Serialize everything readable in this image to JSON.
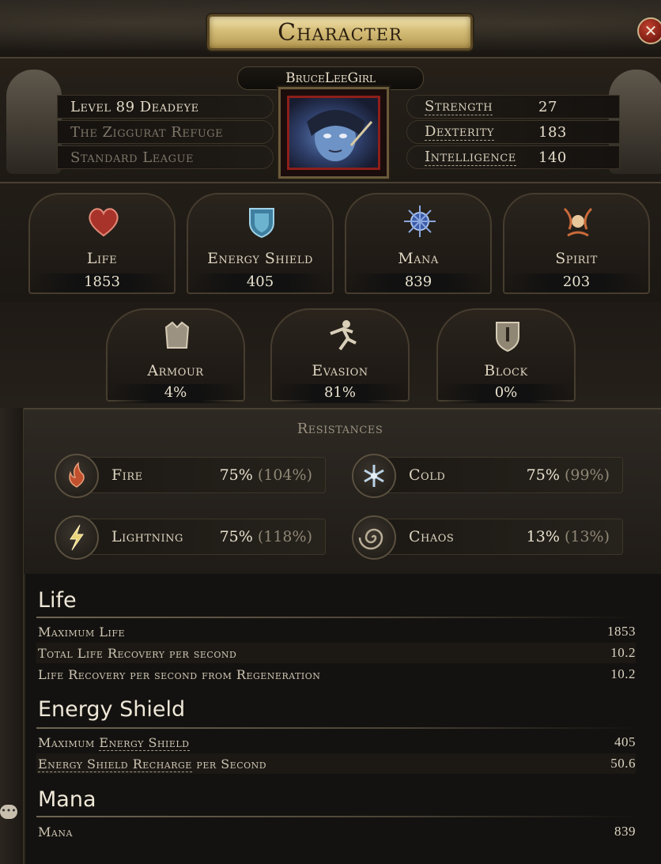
{
  "window": {
    "title": "Character",
    "close_icon": "close-icon"
  },
  "character": {
    "name": "BruceLeeGirl",
    "level_class": "Level 89 Deadeye",
    "location": "The Ziggurat Refuge",
    "league": "Standard League"
  },
  "attributes": [
    {
      "label": "Strength",
      "value": "27"
    },
    {
      "label": "Dexterity",
      "value": "183"
    },
    {
      "label": "Intelligence",
      "value": "140"
    }
  ],
  "main_stats": [
    {
      "label": "Life",
      "value": "1853",
      "icon": "heart-icon"
    },
    {
      "label": "Energy Shield",
      "value": "405",
      "icon": "shield-icon"
    },
    {
      "label": "Mana",
      "value": "839",
      "icon": "mana-icon"
    },
    {
      "label": "Spirit",
      "value": "203",
      "icon": "spirit-icon"
    }
  ],
  "defences": [
    {
      "label": "Armour",
      "value": "4%",
      "icon": "armour-icon"
    },
    {
      "label": "Evasion",
      "value": "81%",
      "icon": "evasion-icon"
    },
    {
      "label": "Block",
      "value": "0%",
      "icon": "block-shield-icon"
    }
  ],
  "resistances": {
    "title": "Resistances",
    "items": [
      {
        "label": "Fire",
        "value": "75%",
        "max": "(104%)",
        "icon": "fire-icon",
        "color": "#c1502e"
      },
      {
        "label": "Cold",
        "value": "75%",
        "max": "(99%)",
        "icon": "snowflake-icon",
        "color": "#bcd3e6"
      },
      {
        "label": "Lightning",
        "value": "75%",
        "max": "(118%)",
        "icon": "lightning-icon",
        "color": "#e8d37a"
      },
      {
        "label": "Chaos",
        "value": "13%",
        "max": "(13%)",
        "icon": "chaos-spiral-icon",
        "color": "#b8ad96"
      }
    ]
  },
  "details": {
    "life": {
      "title": "Life",
      "rows": [
        {
          "label": "Maximum Life",
          "value": "1853"
        },
        {
          "label": "Total Life Recovery per second",
          "value": "10.2"
        },
        {
          "label": "Life Recovery per second from Regeneration",
          "value": "10.2"
        }
      ]
    },
    "energy_shield": {
      "title": "Energy Shield",
      "row1_prefix": "Maximum ",
      "row1_term": "Energy Shield",
      "row1_value": "405",
      "row2_term": "Energy Shield Recharge",
      "row2_suffix": " per Second",
      "row2_value": "50.6"
    },
    "mana": {
      "title": "Mana",
      "rows": [
        {
          "label": "Mana",
          "value": "839"
        }
      ]
    }
  }
}
